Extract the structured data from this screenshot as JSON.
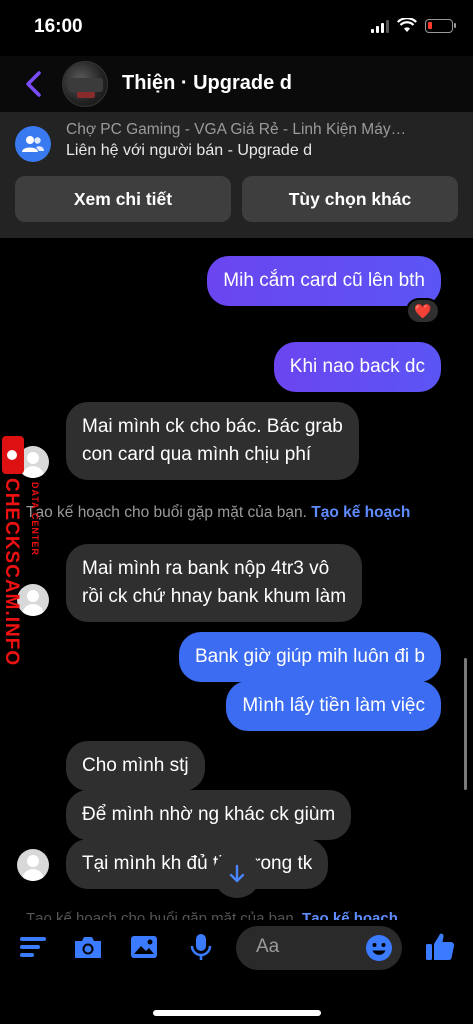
{
  "status_bar": {
    "time": "16:00"
  },
  "header": {
    "title": "Thiện · Upgrade d"
  },
  "listing": {
    "title": "Chợ PC Gaming - VGA Giá Rẻ - Linh Kiện Máy…",
    "subtitle": "Liên hệ với người bán - Upgrade d",
    "details_button": "Xem chi tiết",
    "options_button": "Tùy chọn khác"
  },
  "messages": [
    {
      "direction": "outgoing",
      "text": "Mih cắm card cũ lên bth",
      "reaction": "❤️"
    },
    {
      "direction": "outgoing",
      "text": "Khi nao back dc"
    },
    {
      "direction": "incoming",
      "lines": [
        "Mai mình ck cho bác. Bác grab",
        "con card qua mình chịu phí"
      ]
    },
    {
      "direction": "incoming",
      "lines": [
        "Mai mình ra bank nộp 4tr3 vô",
        "rồi ck chứ hnay bank khum làm"
      ]
    },
    {
      "direction": "outgoing",
      "text": "Bank giờ giúp mih luôn đi b"
    },
    {
      "direction": "outgoing",
      "text": "Mình lấy tiền làm việc"
    },
    {
      "direction": "incoming",
      "text": "Cho mình stj"
    },
    {
      "direction": "incoming",
      "text": "Để mình nhờ ng khác ck giùm"
    },
    {
      "direction": "incoming",
      "text": "Tại mình kh đủ tiền trong tk"
    }
  ],
  "plan_notice": {
    "text": "Tạo kế hoạch cho buổi gặp mặt của bạn.",
    "link": "Tạo kế hoạch"
  },
  "composer": {
    "placeholder": "Aa"
  },
  "watermark": {
    "brand": "CHECKSCAM.INFO",
    "sub": "DATA CENTER"
  },
  "colors": {
    "outgoing_purple": "#6b45f0",
    "outgoing_blue": "#3c6cf2",
    "incoming": "#2f2f2f",
    "accent": "#5f8cff"
  }
}
